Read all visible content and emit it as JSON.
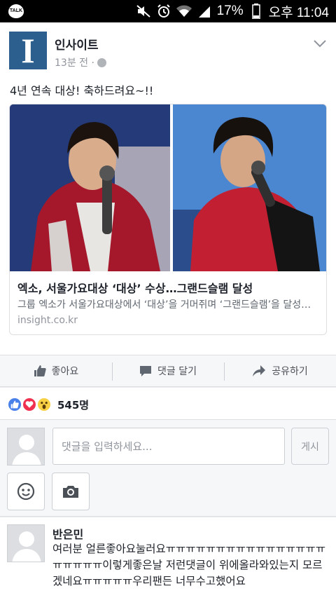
{
  "status_bar": {
    "notification_badge": "TALK",
    "battery": "17%",
    "time": "오후 11:04",
    "icons": [
      "mute-icon",
      "alarm-icon",
      "wifi-icon",
      "signal-icon",
      "battery-icon"
    ]
  },
  "post": {
    "author": "인사이트",
    "logo_letter": "I",
    "time_ago": "13분 전 ·",
    "text": "4년 연속 대상! 축하드려요~!!",
    "link": {
      "title": "엑소, 서울가요대상 ‘대상’ 수상…그랜드슬램 달성",
      "description": "그룹 엑소가 서울가요대상에서 ‘대상’을 거머쥐며 ‘그랜드슬램’을 달성했다.",
      "domain": "insight.co.kr"
    },
    "brand_color": "#2d5f8e"
  },
  "actions": {
    "like": "좋아요",
    "comment": "댓글 달기",
    "share": "공유하기"
  },
  "reactions": {
    "types": [
      "like",
      "love",
      "wow"
    ],
    "count": "545명"
  },
  "composer": {
    "placeholder": "댓글을 입력하세요...",
    "value": "",
    "post_button": "게시"
  },
  "comments": [
    {
      "author": "반은민",
      "text": "여러분 얼른좋아요눌러요ㅠㅠㅠㅠㅠㅠㅠㅠㅠㅠㅠㅠㅠㅠㅠㅠㅠㅠㅠㅠㅠ이렇게좋은날 저런댓글이 위에올라와있는지 모르겠네요ㅠㅠㅠㅠㅠ우리팬든 너무수고했어요"
    }
  ]
}
